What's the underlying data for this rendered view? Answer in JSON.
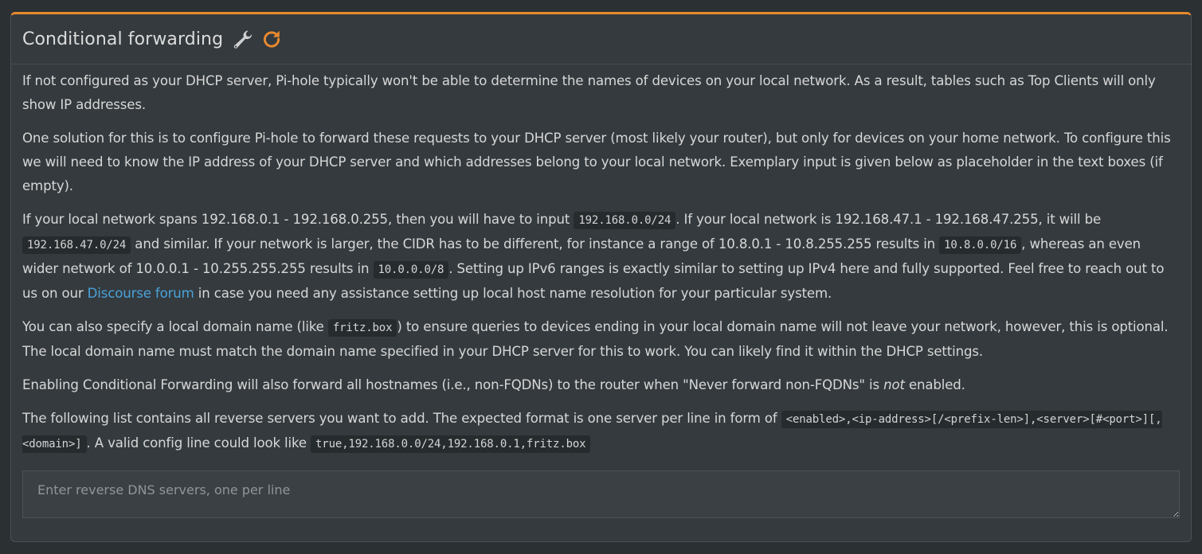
{
  "header": {
    "title": "Conditional forwarding",
    "icons": [
      "wrench-icon",
      "refresh-icon"
    ],
    "accent_color": "#e8892f"
  },
  "paragraphs": {
    "p1": "If not configured as your DHCP server, Pi-hole typically won't be able to determine the names of devices on your local network. As a result, tables such as Top Clients will only show IP addresses.",
    "p2": "One solution for this is to configure Pi-hole to forward these requests to your DHCP server (most likely your router), but only for devices on your home network. To configure this we will need to know the IP address of your DHCP server and which addresses belong to your local network. Exemplary input is given below as placeholder in the text boxes (if empty).",
    "p3": {
      "t1": "If your local network spans 192.168.0.1 - 192.168.0.255, then you will have to input ",
      "c1": "192.168.0.0/24",
      "t2": ". If your local network is 192.168.47.1 - 192.168.47.255, it will be ",
      "c2": "192.168.47.0/24",
      "t3": " and similar. If your network is larger, the CIDR has to be different, for instance a range of 10.8.0.1 - 10.8.255.255 results in ",
      "c3": "10.8.0.0/16",
      "t4": ", whereas an even wider network of 10.0.0.1 - 10.255.255.255 results in ",
      "c4": "10.0.0.0/8",
      "t5": ". Setting up IPv6 ranges is exactly similar to setting up IPv4 here and fully supported. Feel free to reach out to us on our ",
      "link": "Discourse forum",
      "t6": " in case you need any assistance setting up local host name resolution for your particular system."
    },
    "p4": {
      "t1": "You can also specify a local domain name (like ",
      "c1": "fritz.box",
      "t2": ") to ensure queries to devices ending in your local domain name will not leave your network, however, this is optional. The local domain name must match the domain name specified in your DHCP server for this to work. You can likely find it within the DHCP settings."
    },
    "p5": {
      "t1": "Enabling Conditional Forwarding will also forward all hostnames (i.e., non-FQDNs) to the router when \"Never forward non-FQDNs\" is ",
      "em": "not",
      "t2": " enabled."
    },
    "p6": {
      "t1": "The following list contains all reverse servers you want to add. The expected format is one server per line in form of ",
      "c1": "<enabled>,<ip-address>[/<prefix-len>],<server>[#<port>][,<domain>]",
      "t2": ". A valid config line could look like ",
      "c2": "true,192.168.0.0/24,192.168.0.1,fritz.box"
    }
  },
  "reverse_servers": {
    "value": "",
    "placeholder": "Enter reverse DNS servers, one per line"
  }
}
